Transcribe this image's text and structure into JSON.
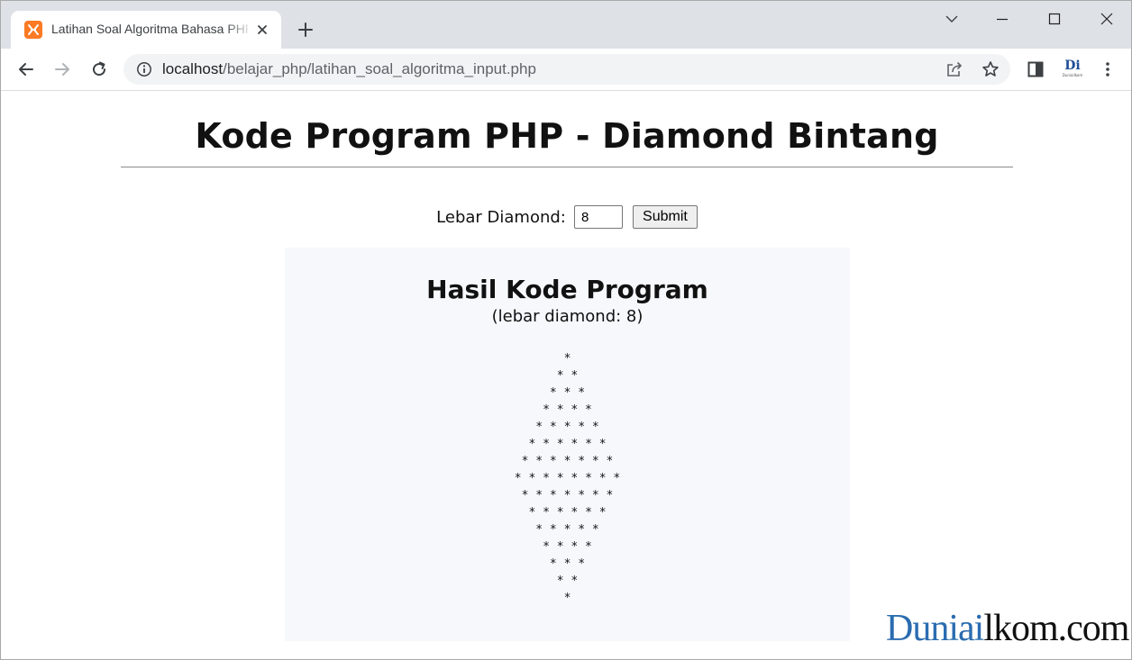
{
  "browser": {
    "tab_title": "Latihan Soal Algoritma Bahasa PHP",
    "url_host": "localhost",
    "url_path": "/belajar_php/latihan_soal_algoritma_input.php",
    "extension_label": "Di",
    "extension_sublabel": "Duniailkom",
    "favicon_color": "#fb7a24",
    "accent_color": "#dee1e6"
  },
  "page": {
    "title": "Kode Program PHP - Diamond Bintang",
    "form": {
      "label": "Lebar Diamond:",
      "input_value": "8",
      "submit_label": "Submit"
    },
    "result": {
      "title": "Hasil Kode Program",
      "subtitle": "(lebar diamond: 8)",
      "diamond_rows": [
        "*",
        "* *",
        "* * *",
        "* * * *",
        "* * * * *",
        "* * * * * *",
        "* * * * * * *",
        "* * * * * * * *",
        "* * * * * * *",
        "* * * * * *",
        "* * * * *",
        "* * * *",
        "* * *",
        "* *",
        "*"
      ]
    },
    "watermark": {
      "part1": "Duniai",
      "part2": "lkom.com",
      "color_part1": "#2b6cb0"
    }
  }
}
